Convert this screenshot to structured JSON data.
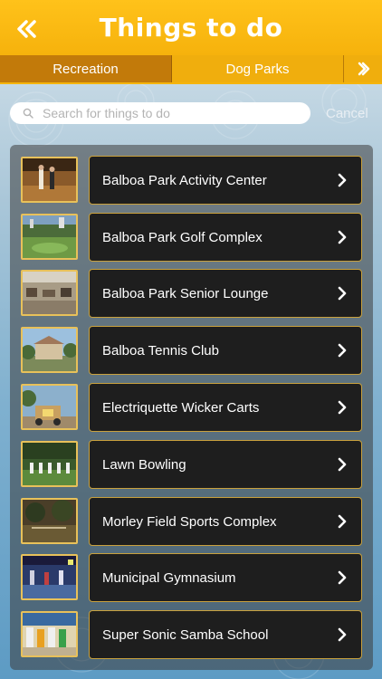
{
  "header": {
    "title": "Things to do",
    "back_icon": "double-chevron-left-icon"
  },
  "tabs": [
    {
      "label": "Recreation",
      "active": true
    },
    {
      "label": "Dog Parks",
      "active": false
    }
  ],
  "tabs_next_icon": "chevron-right-icon",
  "search": {
    "placeholder": "Search for things to do",
    "value": "",
    "cancel_label": "Cancel"
  },
  "colors": {
    "header": "#f6b20c",
    "active_tab": "#c27a0a",
    "item_bg": "#1e1e1e",
    "item_border": "#c9a13d"
  },
  "items": [
    {
      "label": "Balboa Park Activity Center"
    },
    {
      "label": "Balboa Park Golf Complex"
    },
    {
      "label": "Balboa Park Senior Lounge"
    },
    {
      "label": "Balboa Tennis Club"
    },
    {
      "label": "Electriquette Wicker Carts"
    },
    {
      "label": "Lawn Bowling"
    },
    {
      "label": "Morley Field Sports Complex"
    },
    {
      "label": "Municipal Gymnasium"
    },
    {
      "label": "Super Sonic Samba School"
    }
  ]
}
